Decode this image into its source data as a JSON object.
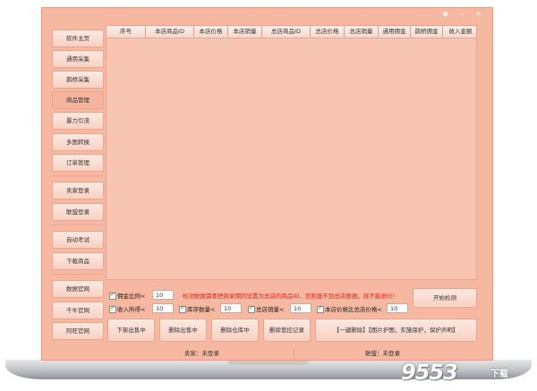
{
  "window": {
    "controls": [
      "♚",
      "–",
      "✕"
    ]
  },
  "sidebar": {
    "items": [
      {
        "label": "软件主页"
      },
      {
        "label": "通用采集"
      },
      {
        "label": "鹊桥采集"
      },
      {
        "label": "商品管理"
      },
      {
        "label": "暴力引流"
      },
      {
        "label": "多图转换"
      },
      {
        "label": "订单管理"
      },
      {
        "label": "卖家登录"
      },
      {
        "label": "联盟登录"
      },
      {
        "label": "自动考试"
      },
      {
        "label": "下载商品"
      },
      {
        "label": "数据官网"
      },
      {
        "label": "千牛官网"
      },
      {
        "label": "阿旺官网"
      }
    ]
  },
  "table": {
    "columns": [
      "序号",
      "本店商品ID",
      "本店价格",
      "本店销量",
      "总店商品ID",
      "总店价格",
      "总店销量",
      "通用佣金",
      "鹊桥佣金",
      "收入金额"
    ]
  },
  "filters": {
    "commission_ratio_label": "佣金比例<",
    "commission_ratio_value": "10",
    "notice": "检测数据需要把商家佣的设置为总店的商品ID，否则查不到总店数据，就不能进行！",
    "income_label": "收入所得<",
    "income_value": "10",
    "stock_label": "库存数量<",
    "stock_value": "10",
    "total_sales_label": "总店销量<",
    "total_sales_value": "10",
    "price_ratio_label": "本店价格比总店价格<",
    "price_ratio_value": "10",
    "start_button": "开始检测"
  },
  "actions": {
    "list_out": "下架出售中",
    "delete_selling": "删除出售中",
    "delete_warehouse": "删除仓库中",
    "delete_records": "删除管控记录",
    "one_click": "【一键删除】【图片护图，实施保护，保护声明】"
  },
  "status": {
    "seller": "卖家：未登录",
    "alliance": "联盟：未登录"
  },
  "watermark": {
    "text": "9553",
    "sub": "下载"
  }
}
